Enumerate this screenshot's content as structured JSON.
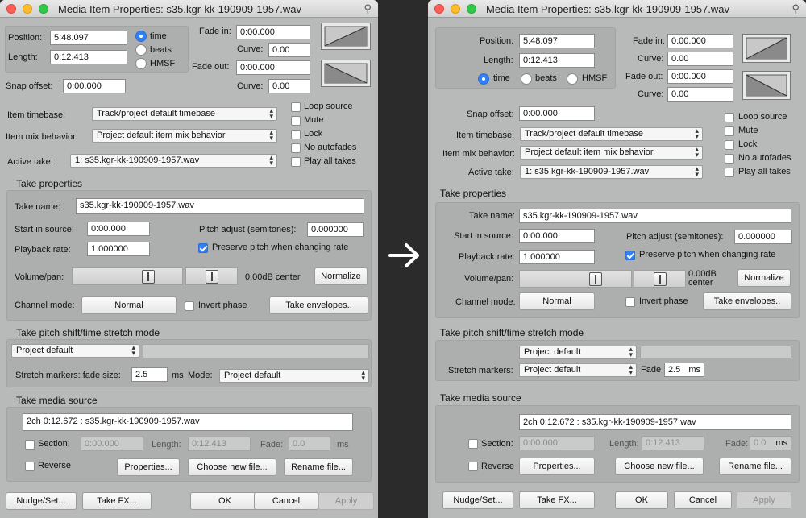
{
  "window_title": "Media Item Properties:  s35.kgr-kk-190909-1957.wav",
  "pin_glyph": "⚲",
  "left": {
    "position_label": "Position:",
    "position_value": "5:48.097",
    "length_label": "Length:",
    "length_value": "0:12.413",
    "radio_time": "time",
    "radio_beats": "beats",
    "radio_hmsf": "HMSF",
    "fade_in_label": "Fade in:",
    "fade_in_value": "0:00.000",
    "curve_label": "Curve:",
    "curve_in_value": "0.00",
    "fade_out_label": "Fade out:",
    "fade_out_value": "0:00.000",
    "curve_out_value": "0.00",
    "snap_label": "Snap offset:",
    "snap_value": "0:00.000",
    "timebase_label": "Item timebase:",
    "timebase_value": "Track/project default timebase",
    "mix_label": "Item mix behavior:",
    "mix_value": "Project default item mix behavior",
    "active_take_label": "Active take:",
    "active_take_value": "1: s35.kgr-kk-190909-1957.wav",
    "checks": [
      "Loop source",
      "Mute",
      "Lock",
      "No autofades",
      "Play all takes"
    ],
    "take_props_header": "Take properties",
    "take_name_label": "Take name:",
    "take_name_value": "s35.kgr-kk-190909-1957.wav",
    "start_label": "Start in source:",
    "start_value": "0:00.000",
    "pitch_label": "Pitch adjust (semitones):",
    "pitch_value": "0.000000",
    "rate_label": "Playback rate:",
    "rate_value": "1.000000",
    "preserve_label": "Preserve pitch when changing rate",
    "volpan_label": "Volume/pan:",
    "volpan_readout": "0.00dB   center",
    "normalize": "Normalize",
    "channel_label": "Channel mode:",
    "channel_value": "Normal",
    "invert_label": "Invert phase",
    "envelopes": "Take envelopes..",
    "pitchshift_header": "Take pitch shift/time stretch mode",
    "pitchshift_value": "Project default",
    "stretch_label": "Stretch markers: fade size:",
    "stretch_value": "2.5",
    "ms": "ms",
    "mode_label": "Mode:",
    "mode_value": "Project default",
    "media_header": "Take media source",
    "source_value": "2ch 0:12.672 : s35.kgr-kk-190909-1957.wav",
    "section_label": "Section:",
    "section_value": "0:00.000",
    "length2_label": "Length:",
    "length2_value": "0:12.413",
    "fade2_label": "Fade:",
    "fade2_value": "0.0",
    "reverse_label": "Reverse",
    "properties": "Properties...",
    "new_file": "Choose new file...",
    "rename": "Rename file...",
    "nudge": "Nudge/Set...",
    "takefx": "Take FX...",
    "ok": "OK",
    "cancel": "Cancel",
    "apply": "Apply"
  },
  "right": {
    "position_label": "Position:",
    "position_value": "5:48.097",
    "length_label": "Length:",
    "length_value": "0:12.413",
    "radio_time": "time",
    "radio_beats": "beats",
    "radio_hmsf": "HMSF",
    "fade_in_label": "Fade in:",
    "fade_in_value": "0:00.000",
    "curve_label": "Curve:",
    "curve_in_value": "0.00",
    "fade_out_label": "Fade out:",
    "fade_out_value": "0:00.000",
    "curve_out_value": "0.00",
    "snap_label": "Snap offset:",
    "snap_value": "0:00.000",
    "timebase_label": "Item timebase:",
    "timebase_value": "Track/project default timebase",
    "mix_label": "Item mix behavior:",
    "mix_value": "Project default item mix behavior",
    "active_take_label": "Active take:",
    "active_take_value": "1: s35.kgr-kk-190909-1957.wav",
    "checks": [
      "Loop source",
      "Mute",
      "Lock",
      "No autofades",
      "Play all takes"
    ],
    "take_props_header": "Take properties",
    "take_name_label": "Take name:",
    "take_name_value": "s35.kgr-kk-190909-1957.wav",
    "start_label": "Start in source:",
    "start_value": "0:00.000",
    "pitch_label": "Pitch adjust (semitones):",
    "pitch_value": "0.000000",
    "rate_label": "Playback rate:",
    "rate_value": "1.000000",
    "preserve_label": "Preserve pitch when changing rate",
    "volpan_label": "Volume/pan:",
    "vol_readout": "0.00dB",
    "pan_readout": "center",
    "normalize": "Normalize",
    "channel_label": "Channel mode:",
    "channel_value": "Normal",
    "invert_label": "Invert phase",
    "envelopes": "Take envelopes..",
    "pitchshift_header": "Take pitch shift/time stretch mode",
    "pitchshift_value": "Project default",
    "stretch_label": "Stretch markers:",
    "stretch_mode_value": "Project default",
    "fade_label": "Fade",
    "stretch_value": "2.5",
    "ms": "ms",
    "media_header": "Take media source",
    "source_value": "2ch 0:12.672 : s35.kgr-kk-190909-1957.wav",
    "section_label": "Section:",
    "section_value": "0:00.000",
    "length2_label": "Length:",
    "length2_value": "0:12.413",
    "fade2_label": "Fade:",
    "fade2_value": "0.0",
    "reverse_label": "Reverse",
    "properties": "Properties...",
    "new_file": "Choose new file...",
    "rename": "Rename file...",
    "nudge": "Nudge/Set...",
    "takefx": "Take FX...",
    "ok": "OK",
    "cancel": "Cancel",
    "apply": "Apply"
  },
  "arrow_glyph": "right-arrow-icon"
}
